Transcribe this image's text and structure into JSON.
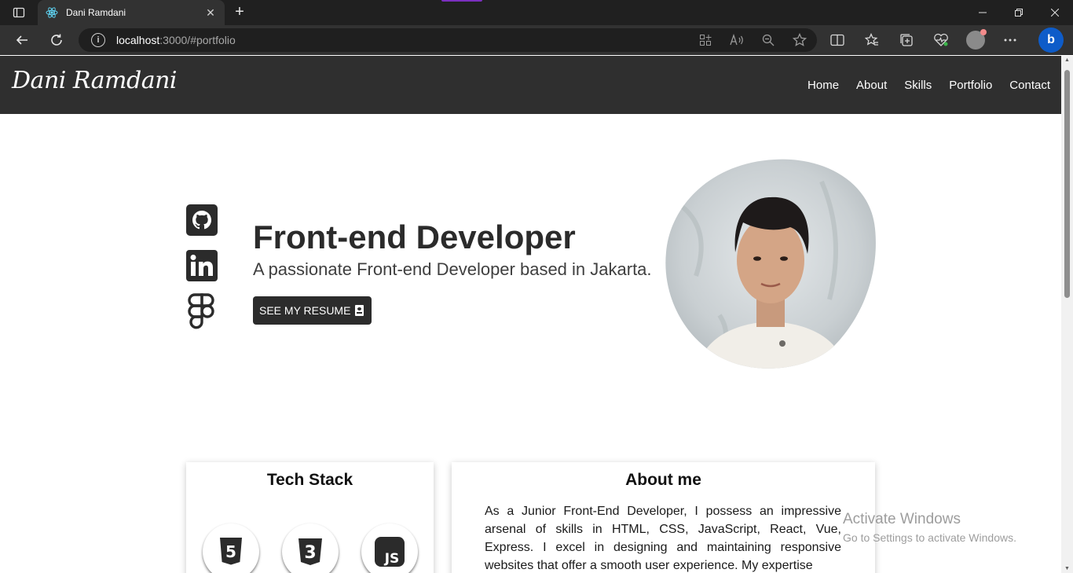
{
  "browser": {
    "tab_title": "Dani Ramdani",
    "url_host": "localhost",
    "url_path": ":3000/#portfolio"
  },
  "site": {
    "logo": "Dani Ramdani",
    "nav": [
      "Home",
      "About",
      "Skills",
      "Portfolio",
      "Contact"
    ]
  },
  "hero": {
    "title": "Front-end Developer",
    "subtitle": "A passionate Front-end Developer based in Jakarta.",
    "resume_button": "SEE MY RESUME",
    "socials": [
      "github-icon",
      "linkedin-icon",
      "figma-icon"
    ]
  },
  "tech_stack": {
    "title": "Tech Stack",
    "icons": [
      "html5-icon",
      "css3-icon",
      "javascript-icon"
    ],
    "js_label": "JS",
    "html_label": "5",
    "css_label": "3"
  },
  "about": {
    "title": "About me",
    "text": "As a Junior Front-End Developer, I possess an impressive arsenal of skills in HTML, CSS, JavaScript, React, Vue, Express. I excel in designing and maintaining responsive websites that offer a smooth user experience. My expertise"
  },
  "watermark": {
    "title": "Activate Windows",
    "subtitle": "Go to Settings to activate Windows."
  },
  "colors": {
    "navbar": "#2f2f2f",
    "accent_dark": "#2c2c2c",
    "browser_bg": "#202020"
  }
}
